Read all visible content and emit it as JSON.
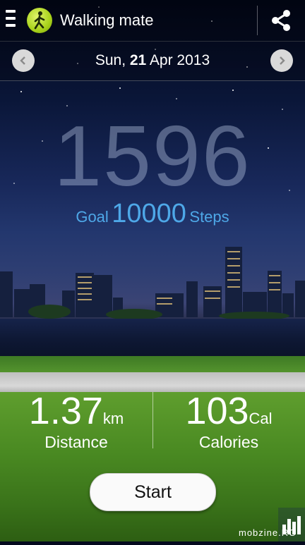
{
  "app": {
    "title": "Walking mate",
    "menu_icon": "menu-icon",
    "logo_icon": "walking-person-icon",
    "share_icon": "share-icon"
  },
  "date": {
    "weekday": "Sun,",
    "day": "21",
    "month_year": "Apr 2013",
    "prev_icon": "chevron-left-icon",
    "next_icon": "chevron-right-icon"
  },
  "steps": {
    "count": "1596",
    "goal_prefix": "Goal",
    "goal_value": "10000",
    "goal_suffix": "Steps"
  },
  "distance": {
    "value": "1.37",
    "unit": "km",
    "label": "Distance"
  },
  "calories": {
    "value": "103",
    "unit": "Cal",
    "label": "Calories"
  },
  "start_button": {
    "label": "Start"
  },
  "stats_icon": "bar-chart-icon",
  "watermark": "mobzine.RO",
  "colors": {
    "goal_text": "#4ea8e8",
    "logo_green": "#a8d21a"
  }
}
